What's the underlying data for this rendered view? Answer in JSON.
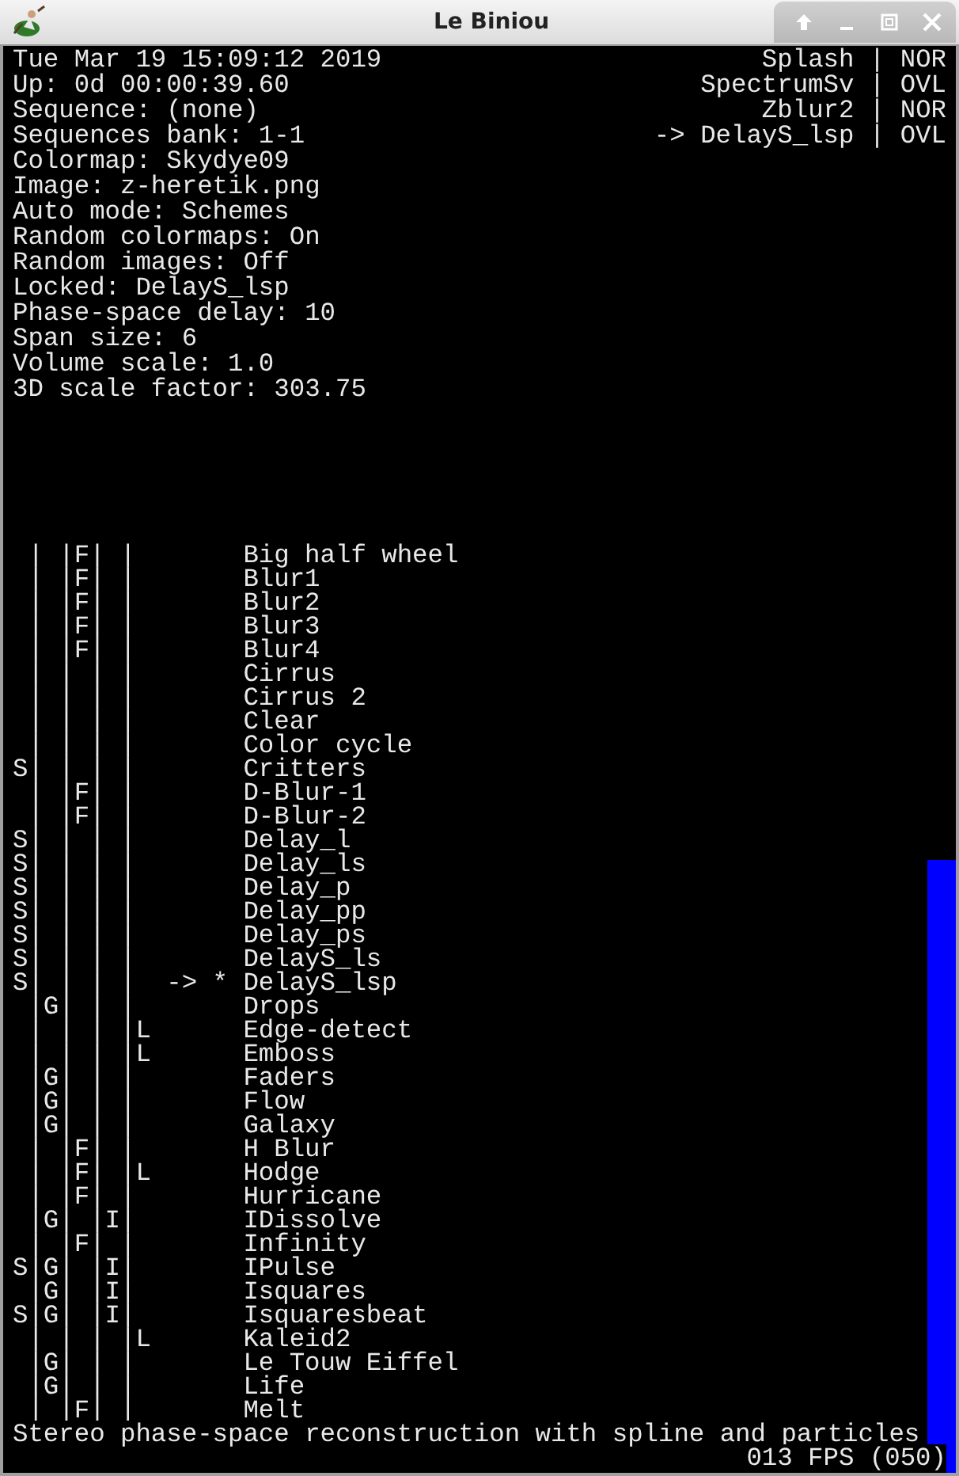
{
  "window": {
    "title": "Le Biniou"
  },
  "status_left": [
    "Tue Mar 19 15:09:12 2019",
    "Up: 0d 00:00:39.60",
    "Sequence: (none)",
    "Sequences bank: 1-1",
    "Colormap: Skydye09",
    "Image: z-heretik.png",
    "Auto mode: Schemes",
    "Random colormaps: On",
    "Random images: Off",
    "Locked: DelayS_lsp",
    "Phase-space delay: 10",
    "Span size: 6",
    "Volume scale: 1.0",
    "3D scale factor: 303.75"
  ],
  "layers": [
    "Splash | NOR",
    "SpectrumSv | OVL",
    "Zblur2 | NOR",
    "-> DelayS_lsp | OVL"
  ],
  "plugins": [
    {
      "flags": " | |F| |",
      "name": "Big half wheel"
    },
    {
      "flags": " | |F| |",
      "name": "Blur1"
    },
    {
      "flags": " | |F| |",
      "name": "Blur2"
    },
    {
      "flags": " | |F| |",
      "name": "Blur3"
    },
    {
      "flags": " | |F| |",
      "name": "Blur4"
    },
    {
      "flags": " | | | |",
      "name": "Cirrus"
    },
    {
      "flags": " | | | |",
      "name": "Cirrus 2"
    },
    {
      "flags": " | | | |",
      "name": "Clear"
    },
    {
      "flags": " | | | |",
      "name": "Color cycle"
    },
    {
      "flags": "S| | | |",
      "name": "Critters"
    },
    {
      "flags": " | |F| |",
      "name": "D-Blur-1"
    },
    {
      "flags": " | |F| |",
      "name": "D-Blur-2"
    },
    {
      "flags": "S| | | |",
      "name": "Delay_l"
    },
    {
      "flags": "S| | | |",
      "name": "Delay_ls"
    },
    {
      "flags": "S| | | |",
      "name": "Delay_p"
    },
    {
      "flags": "S| | | |",
      "name": "Delay_pp"
    },
    {
      "flags": "S| | | |",
      "name": "Delay_ps"
    },
    {
      "flags": "S| | | |",
      "name": "DelayS_ls"
    },
    {
      "flags": "S| | | |",
      "name": "DelayS_lsp",
      "marker": "-> *"
    },
    {
      "flags": " |G| | |",
      "name": "Drops"
    },
    {
      "flags": " | | | |L",
      "name": "Edge-detect"
    },
    {
      "flags": " | | | |L",
      "name": "Emboss"
    },
    {
      "flags": " |G| | |",
      "name": "Faders"
    },
    {
      "flags": " |G| | |",
      "name": "Flow"
    },
    {
      "flags": " |G| | |",
      "name": "Galaxy"
    },
    {
      "flags": " | |F| |",
      "name": "H Blur"
    },
    {
      "flags": " | |F| |L",
      "name": "Hodge"
    },
    {
      "flags": " | |F| |",
      "name": "Hurricane"
    },
    {
      "flags": " |G| |I|",
      "name": "IDissolve"
    },
    {
      "flags": " | |F| |",
      "name": "Infinity"
    },
    {
      "flags": "S|G| |I|",
      "name": "IPulse"
    },
    {
      "flags": " |G| |I|",
      "name": "Isquares"
    },
    {
      "flags": "S|G| |I|",
      "name": "Isquaresbeat"
    },
    {
      "flags": " | | | |L",
      "name": "Kaleid2"
    },
    {
      "flags": " |G| | |",
      "name": "Le Touw Eiffel"
    },
    {
      "flags": " |G| | |",
      "name": "Life"
    },
    {
      "flags": " | |F| |",
      "name": "Melt"
    }
  ],
  "description": "Stereo phase-space reconstruction with spline and particles",
  "fps": "013 FPS (050)",
  "volume_meter": {
    "level": 0.43
  }
}
